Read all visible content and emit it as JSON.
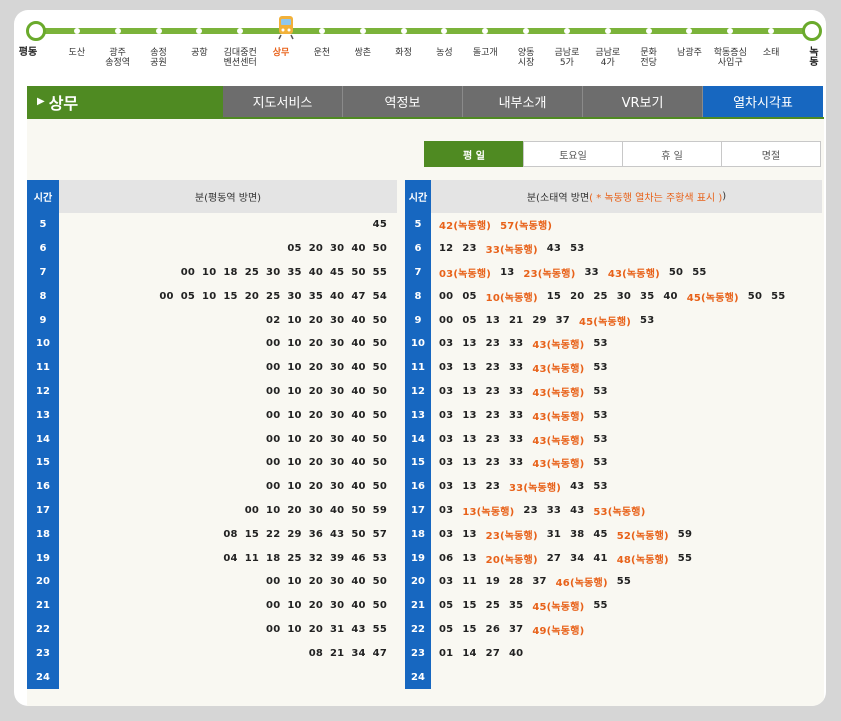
{
  "line": {
    "stations": [
      {
        "name": "평동",
        "end": true
      },
      {
        "name": "도산"
      },
      {
        "name": "광주\n송정역"
      },
      {
        "name": "송정\n공원"
      },
      {
        "name": "공항"
      },
      {
        "name": "김대중컨\n벤션센터"
      },
      {
        "name": "상무",
        "current": true
      },
      {
        "name": "운천"
      },
      {
        "name": "쌍촌"
      },
      {
        "name": "화정"
      },
      {
        "name": "농성"
      },
      {
        "name": "돌고개"
      },
      {
        "name": "양동\n시장"
      },
      {
        "name": "금남로\n5가"
      },
      {
        "name": "금남로\n4가"
      },
      {
        "name": "문화\n전당"
      },
      {
        "name": "남광주"
      },
      {
        "name": "학동증심\n사입구"
      },
      {
        "name": "소태"
      },
      {
        "name": "녹동",
        "end": true
      }
    ]
  },
  "header": {
    "station_name": "상무",
    "tabs": [
      "지도서비스",
      "역정보",
      "내부소개",
      "VR보기",
      "열차시각표"
    ],
    "active_tab": 4
  },
  "day_tabs": {
    "items": [
      "평 일",
      "토요일",
      "휴 일",
      "명절"
    ],
    "active": 0
  },
  "timetable": {
    "hour_label": "시간",
    "left_title": "분(평동역 방면)",
    "right_title_main": "분(소태역 방면 ",
    "right_title_note": "( * 녹동행 열차는 주황색 표시 )",
    "right_title_end": ")",
    "nokdong_suffix": "(녹동행)",
    "rows": [
      {
        "hour": "5",
        "left": [
          "45"
        ],
        "right": [
          [
            "42",
            1
          ],
          [
            "57",
            1
          ]
        ]
      },
      {
        "hour": "6",
        "left": [
          "05",
          "20",
          "30",
          "40",
          "50"
        ],
        "right": [
          [
            "12",
            0
          ],
          [
            "23",
            0
          ],
          [
            "33",
            1
          ],
          [
            "43",
            0
          ],
          [
            "53",
            0
          ]
        ]
      },
      {
        "hour": "7",
        "left": [
          "00",
          "10",
          "18",
          "25",
          "30",
          "35",
          "40",
          "45",
          "50",
          "55"
        ],
        "right": [
          [
            "03",
            1
          ],
          [
            "13",
            0
          ],
          [
            "23",
            1
          ],
          [
            "33",
            0
          ],
          [
            "43",
            1
          ],
          [
            "50",
            0
          ],
          [
            "55",
            0
          ]
        ]
      },
      {
        "hour": "8",
        "left": [
          "00",
          "05",
          "10",
          "15",
          "20",
          "25",
          "30",
          "35",
          "40",
          "47",
          "54"
        ],
        "right": [
          [
            "00",
            0
          ],
          [
            "05",
            0
          ],
          [
            "10",
            1
          ],
          [
            "15",
            0
          ],
          [
            "20",
            0
          ],
          [
            "25",
            0
          ],
          [
            "30",
            0
          ],
          [
            "35",
            0
          ],
          [
            "40",
            0
          ],
          [
            "45",
            1
          ],
          [
            "50",
            0
          ],
          [
            "55",
            0
          ]
        ]
      },
      {
        "hour": "9",
        "left": [
          "02",
          "10",
          "20",
          "30",
          "40",
          "50"
        ],
        "right": [
          [
            "00",
            0
          ],
          [
            "05",
            0
          ],
          [
            "13",
            0
          ],
          [
            "21",
            0
          ],
          [
            "29",
            0
          ],
          [
            "37",
            0
          ],
          [
            "45",
            1
          ],
          [
            "53",
            0
          ]
        ]
      },
      {
        "hour": "10",
        "left": [
          "00",
          "10",
          "20",
          "30",
          "40",
          "50"
        ],
        "right": [
          [
            "03",
            0
          ],
          [
            "13",
            0
          ],
          [
            "23",
            0
          ],
          [
            "33",
            0
          ],
          [
            "43",
            1
          ],
          [
            "53",
            0
          ]
        ]
      },
      {
        "hour": "11",
        "left": [
          "00",
          "10",
          "20",
          "30",
          "40",
          "50"
        ],
        "right": [
          [
            "03",
            0
          ],
          [
            "13",
            0
          ],
          [
            "23",
            0
          ],
          [
            "33",
            0
          ],
          [
            "43",
            1
          ],
          [
            "53",
            0
          ]
        ]
      },
      {
        "hour": "12",
        "left": [
          "00",
          "10",
          "20",
          "30",
          "40",
          "50"
        ],
        "right": [
          [
            "03",
            0
          ],
          [
            "13",
            0
          ],
          [
            "23",
            0
          ],
          [
            "33",
            0
          ],
          [
            "43",
            1
          ],
          [
            "53",
            0
          ]
        ]
      },
      {
        "hour": "13",
        "left": [
          "00",
          "10",
          "20",
          "30",
          "40",
          "50"
        ],
        "right": [
          [
            "03",
            0
          ],
          [
            "13",
            0
          ],
          [
            "23",
            0
          ],
          [
            "33",
            0
          ],
          [
            "43",
            1
          ],
          [
            "53",
            0
          ]
        ]
      },
      {
        "hour": "14",
        "left": [
          "00",
          "10",
          "20",
          "30",
          "40",
          "50"
        ],
        "right": [
          [
            "03",
            0
          ],
          [
            "13",
            0
          ],
          [
            "23",
            0
          ],
          [
            "33",
            0
          ],
          [
            "43",
            1
          ],
          [
            "53",
            0
          ]
        ]
      },
      {
        "hour": "15",
        "left": [
          "00",
          "10",
          "20",
          "30",
          "40",
          "50"
        ],
        "right": [
          [
            "03",
            0
          ],
          [
            "13",
            0
          ],
          [
            "23",
            0
          ],
          [
            "33",
            0
          ],
          [
            "43",
            1
          ],
          [
            "53",
            0
          ]
        ]
      },
      {
        "hour": "16",
        "left": [
          "00",
          "10",
          "20",
          "30",
          "40",
          "50"
        ],
        "right": [
          [
            "03",
            0
          ],
          [
            "13",
            0
          ],
          [
            "23",
            0
          ],
          [
            "33",
            1
          ],
          [
            "43",
            0
          ],
          [
            "53",
            0
          ]
        ]
      },
      {
        "hour": "17",
        "left": [
          "00",
          "10",
          "20",
          "30",
          "40",
          "50",
          "59"
        ],
        "right": [
          [
            "03",
            0
          ],
          [
            "13",
            1
          ],
          [
            "23",
            0
          ],
          [
            "33",
            0
          ],
          [
            "43",
            0
          ],
          [
            "53",
            1
          ]
        ]
      },
      {
        "hour": "18",
        "left": [
          "08",
          "15",
          "22",
          "29",
          "36",
          "43",
          "50",
          "57"
        ],
        "right": [
          [
            "03",
            0
          ],
          [
            "13",
            0
          ],
          [
            "23",
            1
          ],
          [
            "31",
            0
          ],
          [
            "38",
            0
          ],
          [
            "45",
            0
          ],
          [
            "52",
            1
          ],
          [
            "59",
            0
          ]
        ]
      },
      {
        "hour": "19",
        "left": [
          "04",
          "11",
          "18",
          "25",
          "32",
          "39",
          "46",
          "53"
        ],
        "right": [
          [
            "06",
            0
          ],
          [
            "13",
            0
          ],
          [
            "20",
            1
          ],
          [
            "27",
            0
          ],
          [
            "34",
            0
          ],
          [
            "41",
            0
          ],
          [
            "48",
            1
          ],
          [
            "55",
            0
          ]
        ]
      },
      {
        "hour": "20",
        "left": [
          "00",
          "10",
          "20",
          "30",
          "40",
          "50"
        ],
        "right": [
          [
            "03",
            0
          ],
          [
            "11",
            0
          ],
          [
            "19",
            0
          ],
          [
            "28",
            0
          ],
          [
            "37",
            0
          ],
          [
            "46",
            1
          ],
          [
            "55",
            0
          ]
        ]
      },
      {
        "hour": "21",
        "left": [
          "00",
          "10",
          "20",
          "30",
          "40",
          "50"
        ],
        "right": [
          [
            "05",
            0
          ],
          [
            "15",
            0
          ],
          [
            "25",
            0
          ],
          [
            "35",
            0
          ],
          [
            "45",
            1
          ],
          [
            "55",
            0
          ]
        ]
      },
      {
        "hour": "22",
        "left": [
          "00",
          "10",
          "20",
          "31",
          "43",
          "55"
        ],
        "right": [
          [
            "05",
            0
          ],
          [
            "15",
            0
          ],
          [
            "26",
            0
          ],
          [
            "37",
            0
          ],
          [
            "49",
            1
          ]
        ]
      },
      {
        "hour": "23",
        "left": [
          "08",
          "21",
          "34",
          "47"
        ],
        "right": [
          [
            "01",
            0
          ],
          [
            "14",
            0
          ],
          [
            "27",
            0
          ],
          [
            "40",
            0
          ]
        ]
      },
      {
        "hour": "24",
        "left": [],
        "right": []
      }
    ]
  },
  "colors": {
    "green": "#4f8a22",
    "blue": "#1767c0",
    "orange": "#e8621a",
    "gray_tab": "#6d6d6d"
  }
}
